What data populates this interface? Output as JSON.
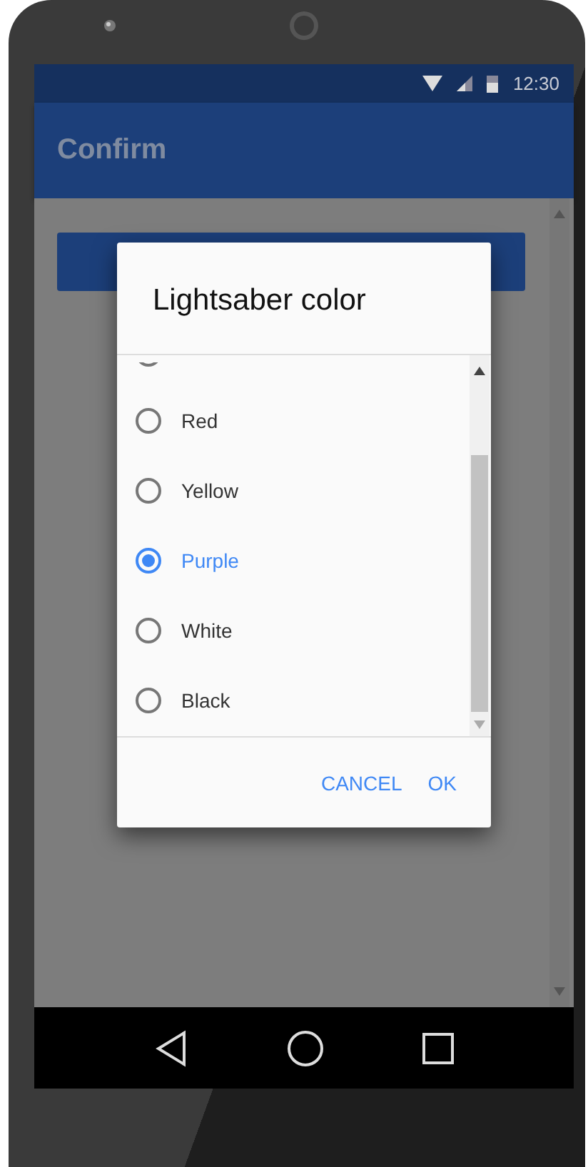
{
  "status_bar": {
    "time": "12:30"
  },
  "app_bar": {
    "title": "Confirm"
  },
  "dialog": {
    "title": "Lightsaber color",
    "options": [
      {
        "label": "Red",
        "selected": false
      },
      {
        "label": "Yellow",
        "selected": false
      },
      {
        "label": "Purple",
        "selected": true
      },
      {
        "label": "White",
        "selected": false
      },
      {
        "label": "Black",
        "selected": false
      }
    ],
    "buttons": [
      "CANCEL",
      "OK"
    ]
  }
}
